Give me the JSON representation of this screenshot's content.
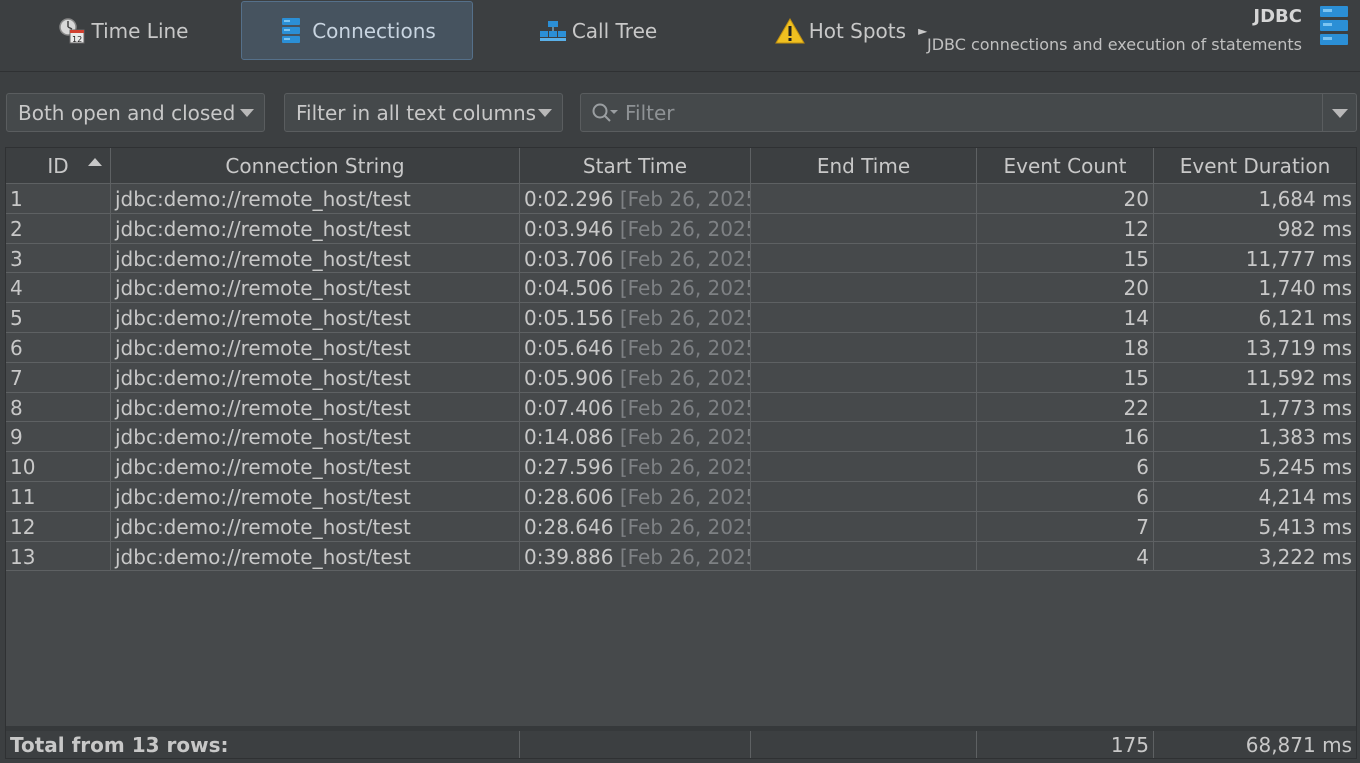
{
  "tabs": [
    {
      "label": "Time Line",
      "icon": "timeline-clock-icon"
    },
    {
      "label": "Connections",
      "icon": "database-icon",
      "active": true
    },
    {
      "label": "Call Tree",
      "icon": "call-tree-icon"
    },
    {
      "label": "Hot Spots",
      "icon": "warning-icon"
    }
  ],
  "header": {
    "title": "JDBC",
    "subtitle": "JDBC connections and execution of statements"
  },
  "filters": {
    "state_value": "Both open and closed",
    "column_value": "Filter in all text columns",
    "search_placeholder": "Filter"
  },
  "table": {
    "columns": [
      "ID",
      "Connection String",
      "Start Time",
      "End Time",
      "Event Count",
      "Event Duration"
    ],
    "rows": [
      {
        "id": "1",
        "conn": "jdbc:demo://remote_host/test",
        "start": "0:02.296",
        "start_date": "[Feb 26, 2025 ...",
        "end": "",
        "count": "20",
        "duration": "1,684 ms"
      },
      {
        "id": "2",
        "conn": "jdbc:demo://remote_host/test",
        "start": "0:03.946",
        "start_date": "[Feb 26, 2025 ...",
        "end": "",
        "count": "12",
        "duration": "982 ms"
      },
      {
        "id": "3",
        "conn": "jdbc:demo://remote_host/test",
        "start": "0:03.706",
        "start_date": "[Feb 26, 2025 ...",
        "end": "",
        "count": "15",
        "duration": "11,777 ms"
      },
      {
        "id": "4",
        "conn": "jdbc:demo://remote_host/test",
        "start": "0:04.506",
        "start_date": "[Feb 26, 2025 ...",
        "end": "",
        "count": "20",
        "duration": "1,740 ms"
      },
      {
        "id": "5",
        "conn": "jdbc:demo://remote_host/test",
        "start": "0:05.156",
        "start_date": "[Feb 26, 2025 ...",
        "end": "",
        "count": "14",
        "duration": "6,121 ms"
      },
      {
        "id": "6",
        "conn": "jdbc:demo://remote_host/test",
        "start": "0:05.646",
        "start_date": "[Feb 26, 2025 ...",
        "end": "",
        "count": "18",
        "duration": "13,719 ms"
      },
      {
        "id": "7",
        "conn": "jdbc:demo://remote_host/test",
        "start": "0:05.906",
        "start_date": "[Feb 26, 2025 ...",
        "end": "",
        "count": "15",
        "duration": "11,592 ms"
      },
      {
        "id": "8",
        "conn": "jdbc:demo://remote_host/test",
        "start": "0:07.406",
        "start_date": "[Feb 26, 2025 ...",
        "end": "",
        "count": "22",
        "duration": "1,773 ms"
      },
      {
        "id": "9",
        "conn": "jdbc:demo://remote_host/test",
        "start": "0:14.086",
        "start_date": "[Feb 26, 2025 ...",
        "end": "",
        "count": "16",
        "duration": "1,383 ms"
      },
      {
        "id": "10",
        "conn": "jdbc:demo://remote_host/test",
        "start": "0:27.596",
        "start_date": "[Feb 26, 2025 ...",
        "end": "",
        "count": "6",
        "duration": "5,245 ms"
      },
      {
        "id": "11",
        "conn": "jdbc:demo://remote_host/test",
        "start": "0:28.606",
        "start_date": "[Feb 26, 2025 ...",
        "end": "",
        "count": "6",
        "duration": "4,214 ms"
      },
      {
        "id": "12",
        "conn": "jdbc:demo://remote_host/test",
        "start": "0:28.646",
        "start_date": "[Feb 26, 2025 ...",
        "end": "",
        "count": "7",
        "duration": "5,413 ms"
      },
      {
        "id": "13",
        "conn": "jdbc:demo://remote_host/test",
        "start": "0:39.886",
        "start_date": "[Feb 26, 2025 ...",
        "end": "",
        "count": "4",
        "duration": "3,222 ms"
      }
    ],
    "footer": {
      "label": "Total from 13 rows:",
      "count": "175",
      "duration": "68,871 ms"
    }
  },
  "colors": {
    "background": "#3c3f41",
    "active_tab": "#46535f",
    "text": "#c8c8c8",
    "dim_text": "#7e8184",
    "accent_blue": "#2b8fd6",
    "warning_yellow": "#f0c020"
  }
}
